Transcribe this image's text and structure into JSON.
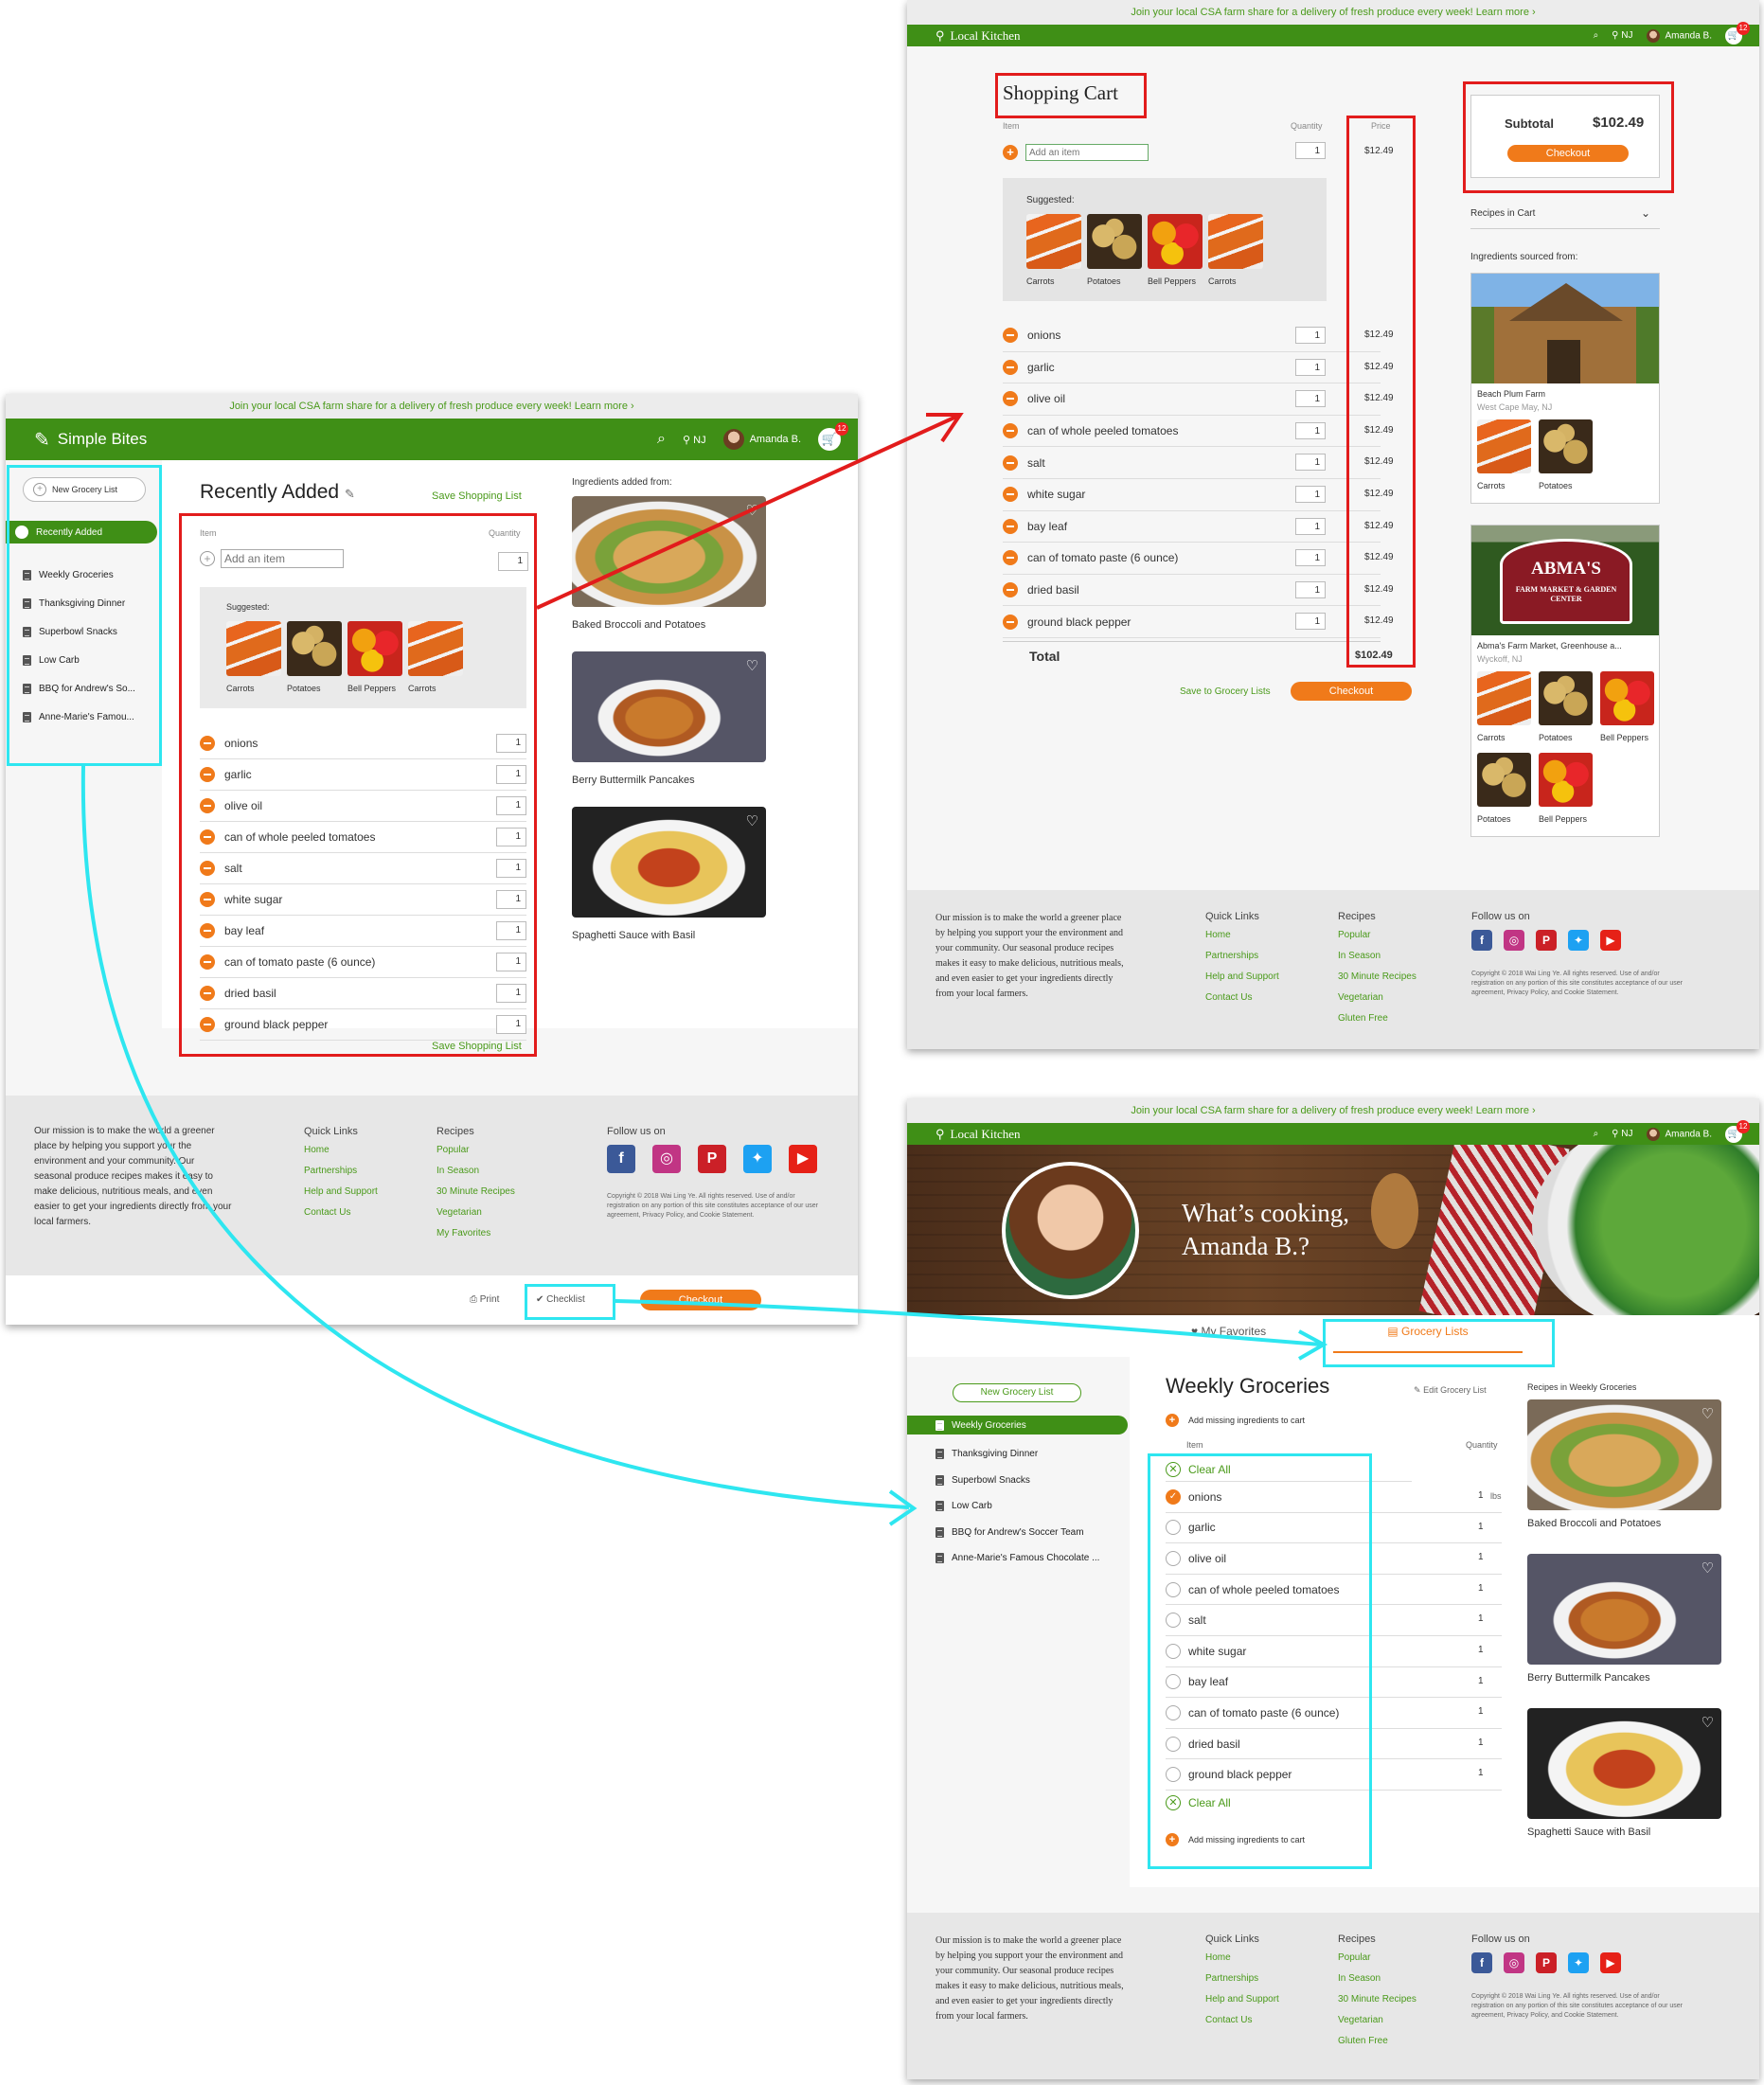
{
  "banner_text": "Join your local CSA farm share for a delivery of fresh produce every week!  Learn more ›",
  "user": {
    "location": "NJ",
    "name": "Amanda B.",
    "cart_count": "12"
  },
  "vegetables": [
    {
      "name": "Carrots"
    },
    {
      "name": "Potatoes"
    },
    {
      "name": "Bell Peppers"
    },
    {
      "name": "Carrots"
    }
  ],
  "ingredients": [
    {
      "name": "onions",
      "qty": "1",
      "price": "$12.49"
    },
    {
      "name": "garlic",
      "qty": "1",
      "price": "$12.49"
    },
    {
      "name": "olive oil",
      "qty": "1",
      "price": "$12.49"
    },
    {
      "name": "can of whole peeled tomatoes",
      "qty": "1",
      "price": "$12.49"
    },
    {
      "name": "salt",
      "qty": "1",
      "price": "$12.49"
    },
    {
      "name": "white sugar",
      "qty": "1",
      "price": "$12.49"
    },
    {
      "name": "bay leaf",
      "qty": "1",
      "price": "$12.49"
    },
    {
      "name": "can of tomato paste (6 ounce)",
      "qty": "1",
      "price": "$12.49"
    },
    {
      "name": "dried basil",
      "qty": "1",
      "price": "$12.49"
    },
    {
      "name": "ground black pepper",
      "qty": "1",
      "price": "$12.49"
    }
  ],
  "recipes": [
    {
      "title": "Baked Broccoli and Potatoes"
    },
    {
      "title": "Berry Buttermilk Pancakes"
    },
    {
      "title": "Spaghetti Sauce with Basil"
    }
  ],
  "footer": {
    "mission": "Our mission is to make the world a greener place by helping you support your the environment and your community. Our seasonal produce recipes makes it easy to make delicious, nutritious meals, and even easier to get your ingredients directly from your local farmers.",
    "quick_links_title": "Quick Links",
    "quick_links": [
      "Home",
      "Partnerships",
      "Help and Support",
      "Contact Us"
    ],
    "recipes_title": "Recipes",
    "recipes_links_a": [
      "Popular",
      "In Season",
      "30 Minute Recipes",
      "Vegetarian",
      "My Favorites"
    ],
    "recipes_links_b": [
      "Popular",
      "In Season",
      "30 Minute Recipes",
      "Vegetarian",
      "Gluten Free"
    ],
    "follow_title": "Follow us on",
    "social": [
      "facebook",
      "instagram",
      "pinterest",
      "twitter",
      "youtube"
    ],
    "copyright": "Copyright © 2018 Wai Ling Ye. All rights reserved. Use of and/or registration on any portion of this site constitutes acceptance of our user agreement, Privacy Policy, and Cookie Statement."
  },
  "screen1": {
    "brand": "Simple Bites",
    "new_list_label": "New Grocery List",
    "sidebar_items": [
      "Recently Added",
      "Weekly Groceries",
      "Thanksgiving Dinner",
      "Superbowl Snacks",
      "Low Carb",
      "BBQ for Andrew's So...",
      "Anne-Marie's Famou..."
    ],
    "title": "Recently Added",
    "save_list": "Save Shopping List",
    "item_header": "Item",
    "quantity_header": "Quantity",
    "add_placeholder": "Add an item",
    "suggested_label": "Suggested:",
    "ingredients_from": "Ingredients added from:",
    "print_label": "Print",
    "checklist_label": "Checklist",
    "checkout_label": "Checkout"
  },
  "screen2": {
    "brand": "Local Kitchen",
    "title": "Shopping Cart",
    "item_header": "Item",
    "quantity_header": "Quantity",
    "price_header": "Price",
    "add_placeholder": "Add an item",
    "add_price": "$12.49",
    "suggested_label": "Suggested:",
    "total_label": "Total",
    "total_value": "$102.49",
    "subtotal_label": "Subtotal",
    "subtotal_value": "$102.49",
    "checkout_label": "Checkout",
    "save_to_lists": "Save to Grocery Lists",
    "recipes_in_cart": "Recipes in Cart",
    "sourced_from": "Ingredients sourced from:",
    "farms": [
      {
        "name": "Beach Plum Farm",
        "location": "West Cape May, NJ",
        "sign_line1": "",
        "sign_line2": "",
        "produce": [
          "Carrots",
          "Potatoes"
        ]
      },
      {
        "name": "Abma's Farm Market, Greenhouse a...",
        "location": "Wyckoff, NJ",
        "sign_line1": "ABMA'S",
        "sign_line2": "FARM MARKET & GARDEN CENTER",
        "produce": [
          "Carrots",
          "Potatoes",
          "Bell Peppers",
          "Potatoes",
          "Bell Peppers"
        ]
      }
    ]
  },
  "screen3": {
    "brand": "Local Kitchen",
    "greeting": "What’s cooking, Amanda B.?",
    "tab_favorites": "My Favorites",
    "tab_grocery": "Grocery Lists",
    "new_list_label": "New Grocery List",
    "sidebar_items": [
      "Weekly Groceries",
      "Thanksgiving Dinner",
      "Superbowl Snacks",
      "Low Carb",
      "BBQ for Andrew's Soccer Team",
      "Anne-Marie's Famous Chocolate ..."
    ],
    "title": "Weekly Groceries",
    "edit_label": "Edit Grocery List",
    "add_missing": "Add missing ingredients to cart",
    "item_header": "Item",
    "quantity_header": "Quantity",
    "clear_all": "Clear All",
    "onion_unit": "lbs",
    "recipes_in_list": "Recipes in Weekly Groceries"
  }
}
